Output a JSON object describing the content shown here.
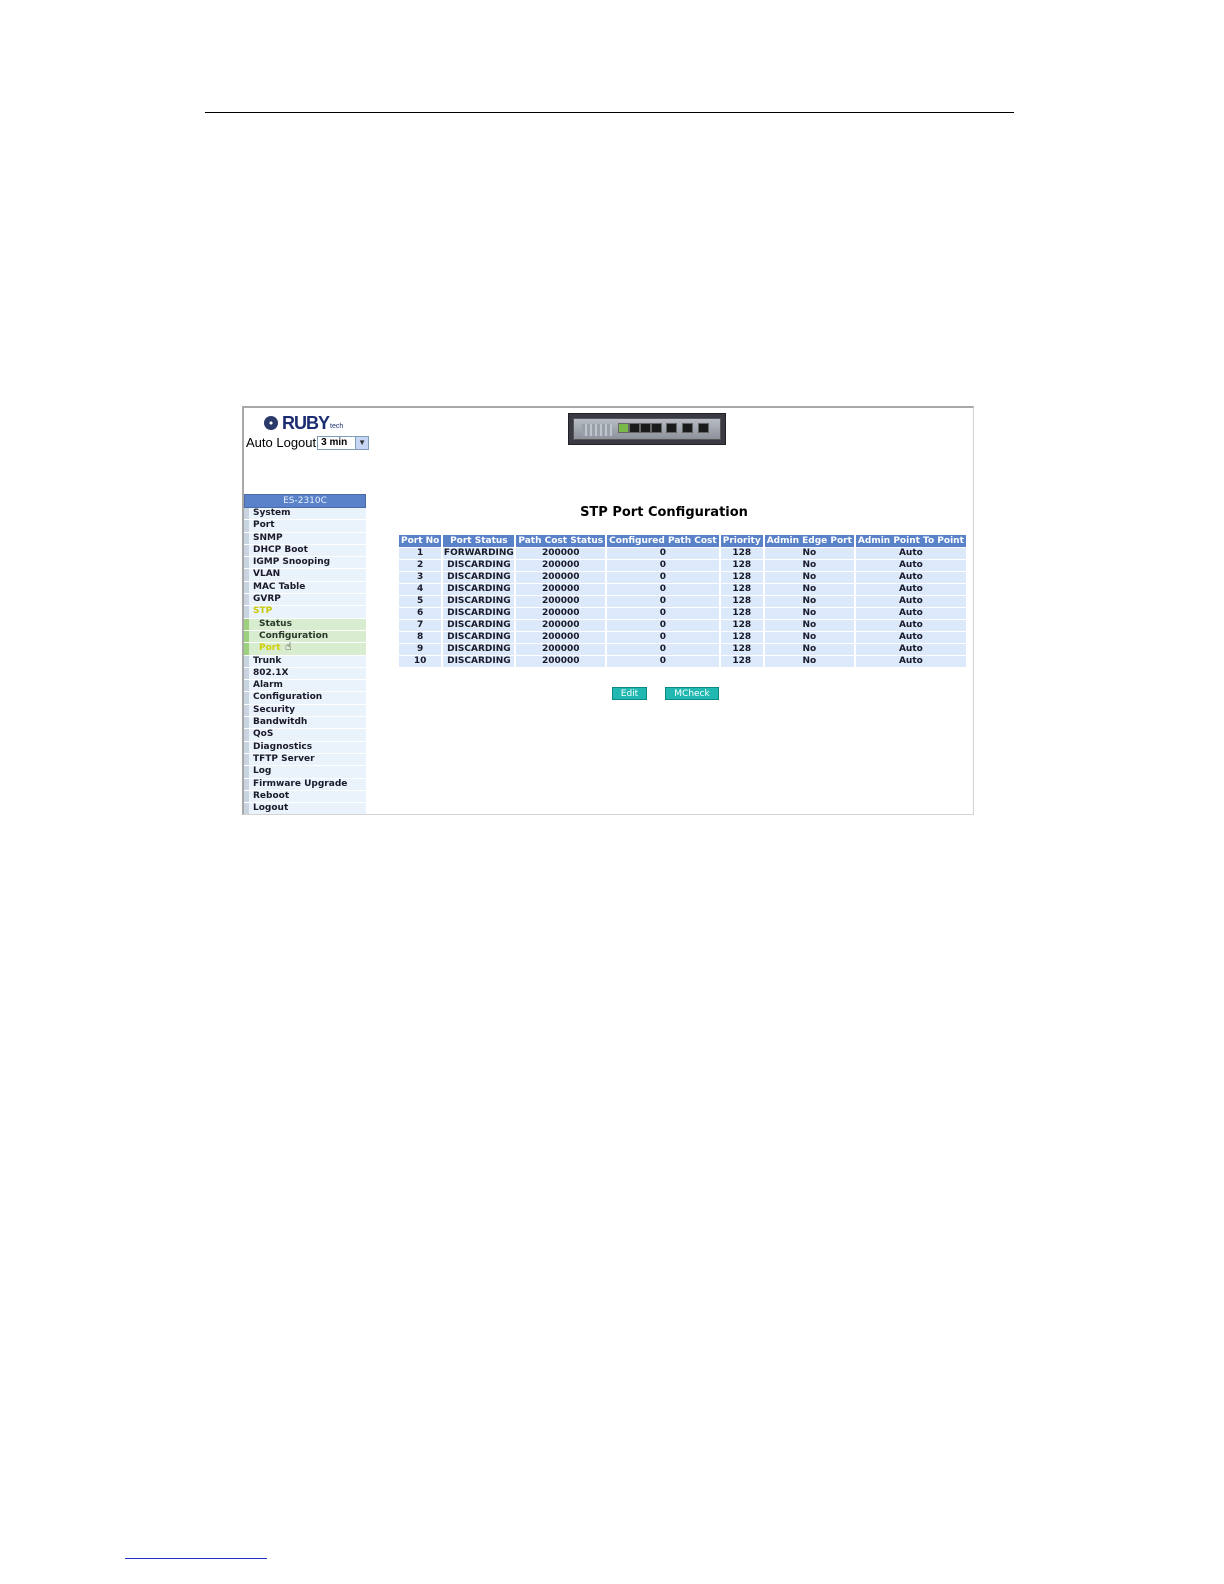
{
  "brand": {
    "logo_text": "RUBY",
    "logo_sub": "tech"
  },
  "auto_logout": {
    "label": "Auto Logout",
    "value": "3 min"
  },
  "sidebar": {
    "title": "ES-2310C",
    "items": [
      {
        "label": "System"
      },
      {
        "label": "Port"
      },
      {
        "label": "SNMP"
      },
      {
        "label": "DHCP Boot"
      },
      {
        "label": "IGMP Snooping"
      },
      {
        "label": "VLAN"
      },
      {
        "label": "MAC Table"
      },
      {
        "label": "GVRP"
      },
      {
        "label": "STP",
        "active": true
      },
      {
        "label": "Status",
        "sub": true
      },
      {
        "label": "Configuration",
        "sub": true
      },
      {
        "label": "Port",
        "sub": true,
        "active": true
      },
      {
        "label": "Trunk"
      },
      {
        "label": "802.1X"
      },
      {
        "label": "Alarm"
      },
      {
        "label": "Configuration"
      },
      {
        "label": "Security"
      },
      {
        "label": "Bandwitdh"
      },
      {
        "label": "QoS"
      },
      {
        "label": "Diagnostics"
      },
      {
        "label": "TFTP Server"
      },
      {
        "label": "Log"
      },
      {
        "label": "Firmware Upgrade"
      },
      {
        "label": "Reboot"
      },
      {
        "label": "Logout"
      }
    ]
  },
  "main": {
    "title": "STP Port Configuration",
    "columns": [
      "Port No",
      "Port Status",
      "Path Cost Status",
      "Configured Path Cost",
      "Priority",
      "Admin Edge Port",
      "Admin Point To Point"
    ],
    "rows": [
      [
        "1",
        "FORWARDING",
        "200000",
        "0",
        "128",
        "No",
        "Auto"
      ],
      [
        "2",
        "DISCARDING",
        "200000",
        "0",
        "128",
        "No",
        "Auto"
      ],
      [
        "3",
        "DISCARDING",
        "200000",
        "0",
        "128",
        "No",
        "Auto"
      ],
      [
        "4",
        "DISCARDING",
        "200000",
        "0",
        "128",
        "No",
        "Auto"
      ],
      [
        "5",
        "DISCARDING",
        "200000",
        "0",
        "128",
        "No",
        "Auto"
      ],
      [
        "6",
        "DISCARDING",
        "200000",
        "0",
        "128",
        "No",
        "Auto"
      ],
      [
        "7",
        "DISCARDING",
        "200000",
        "0",
        "128",
        "No",
        "Auto"
      ],
      [
        "8",
        "DISCARDING",
        "200000",
        "0",
        "128",
        "No",
        "Auto"
      ],
      [
        "9",
        "DISCARDING",
        "200000",
        "0",
        "128",
        "No",
        "Auto"
      ],
      [
        "10",
        "DISCARDING",
        "200000",
        "0",
        "128",
        "No",
        "Auto"
      ]
    ],
    "buttons": {
      "edit": "Edit",
      "mcheck": "MCheck"
    }
  },
  "colors": {
    "header_blue": "#5a82c8",
    "cell_blue": "#dbe9fa",
    "button_teal": "#20b8b0",
    "active_yellow": "#c8c800"
  }
}
